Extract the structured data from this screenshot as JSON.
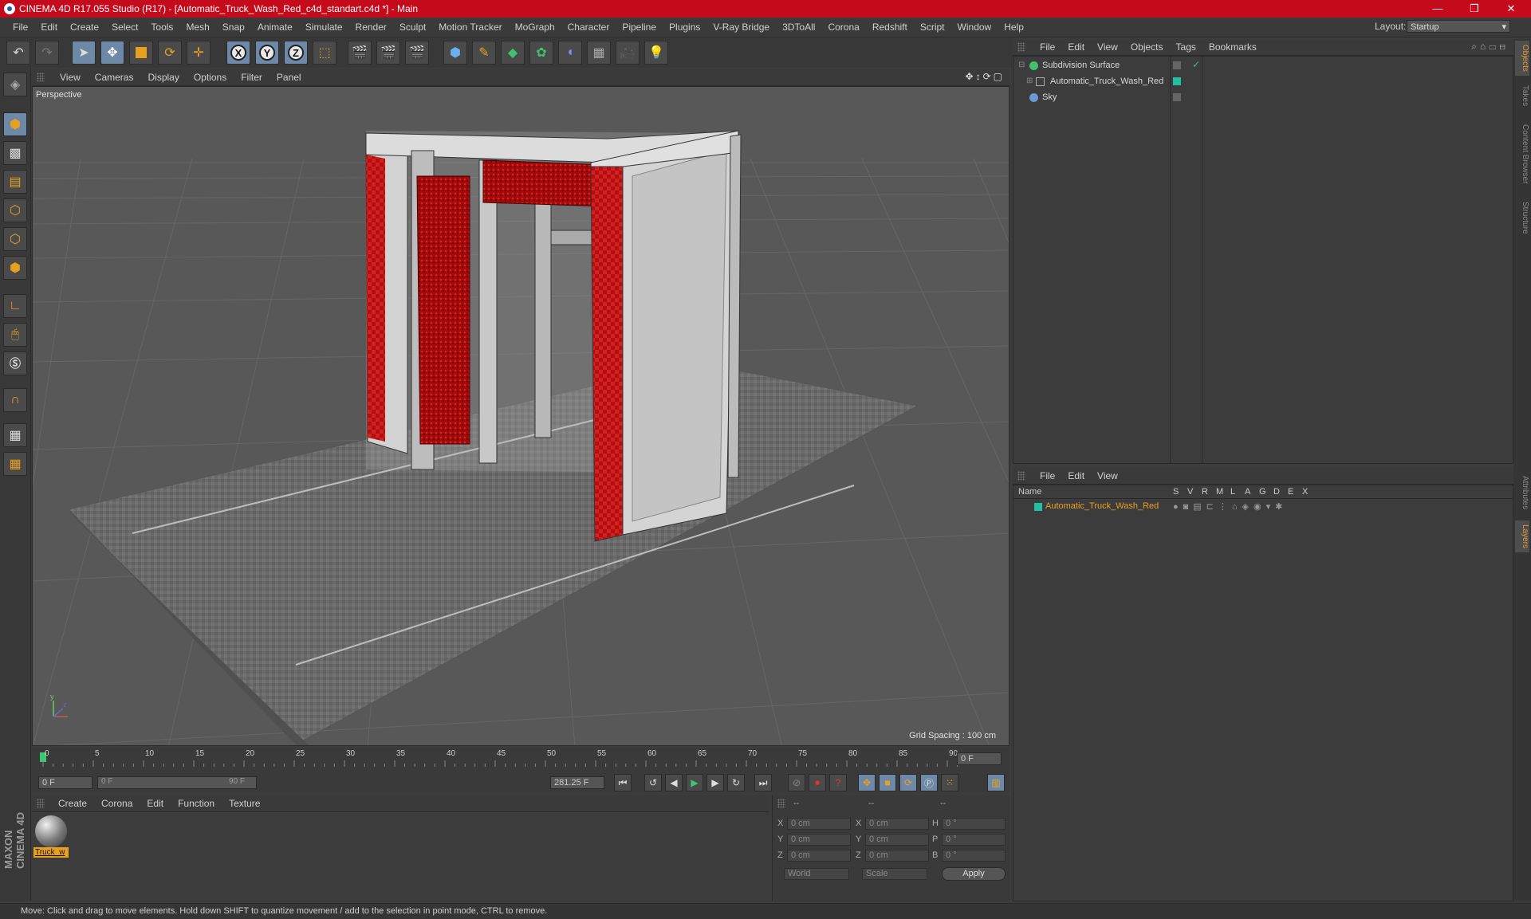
{
  "window": {
    "title": "CINEMA 4D R17.055 Studio (R17) - [Automatic_Truck_Wash_Red_c4d_standart.c4d *] - Main",
    "minimize": "—",
    "maximize": "❐",
    "close": "✕"
  },
  "menubar": {
    "items": [
      "File",
      "Edit",
      "Create",
      "Select",
      "Tools",
      "Mesh",
      "Snap",
      "Animate",
      "Simulate",
      "Render",
      "Sculpt",
      "Motion Tracker",
      "MoGraph",
      "Character",
      "Pipeline",
      "Plugins",
      "V-Ray Bridge",
      "3DToAll",
      "Corona",
      "Redshift",
      "Script",
      "Window",
      "Help"
    ],
    "layout_label": "Layout:",
    "layout_value": "Startup"
  },
  "toolbar": {
    "axis_x": "X",
    "axis_y": "Y",
    "axis_z": "Z"
  },
  "viewport": {
    "menu": [
      "View",
      "Cameras",
      "Display",
      "Options",
      "Filter",
      "Panel"
    ],
    "label": "Perspective",
    "grid_spacing": "Grid Spacing : 100 cm",
    "colors": {
      "background": "#585858",
      "accent": "#c8102e"
    }
  },
  "timeline": {
    "ticks": [
      "0",
      "5",
      "10",
      "15",
      "20",
      "25",
      "30",
      "35",
      "40",
      "45",
      "50",
      "55",
      "60",
      "65",
      "70",
      "75",
      "80",
      "85",
      "90"
    ],
    "current_frame_display": "0 F",
    "start_field": "0 F",
    "range_start": "0 F",
    "range_end": "90 F",
    "end_field": "281.25 F"
  },
  "material_manager": {
    "menu": [
      "Create",
      "Corona",
      "Edit",
      "Function",
      "Texture"
    ],
    "material_label": "Truck_w"
  },
  "coordinates": {
    "header": [
      "--",
      "--",
      "--"
    ],
    "rows": [
      {
        "l1": "X",
        "v1": "0 cm",
        "l2": "X",
        "v2": "0 cm",
        "l3": "H",
        "v3": "0 °"
      },
      {
        "l1": "Y",
        "v1": "0 cm",
        "l2": "Y",
        "v2": "0 cm",
        "l3": "P",
        "v3": "0 °"
      },
      {
        "l1": "Z",
        "v1": "0 cm",
        "l2": "Z",
        "v2": "0 cm",
        "l3": "B",
        "v3": "0 °"
      }
    ],
    "mode_world": "World",
    "mode_scale": "Scale",
    "apply": "Apply"
  },
  "object_manager": {
    "menu": [
      "File",
      "Edit",
      "View",
      "Objects",
      "Tags",
      "Bookmarks"
    ],
    "objects": [
      {
        "name": "Subdivision Surface"
      },
      {
        "name": "Automatic_Truck_Wash_Red"
      },
      {
        "name": "Sky"
      }
    ]
  },
  "layer_manager": {
    "menu": [
      "File",
      "Edit",
      "View"
    ],
    "columns": [
      "Name",
      "S",
      "V",
      "R",
      "M",
      "L",
      "A",
      "G",
      "D",
      "E",
      "X"
    ],
    "layers": [
      {
        "name": "Automatic_Truck_Wash_Red",
        "color": "#1fbfa0"
      }
    ]
  },
  "right_tabs": [
    "Objects",
    "Takes",
    "Content Browser",
    "Structure",
    "Attributes",
    "Layers"
  ],
  "status": "Move: Click and drag to move elements. Hold down SHIFT to quantize movement / add to the selection in point mode, CTRL to remove.",
  "brand": "MAXON CINEMA 4D"
}
